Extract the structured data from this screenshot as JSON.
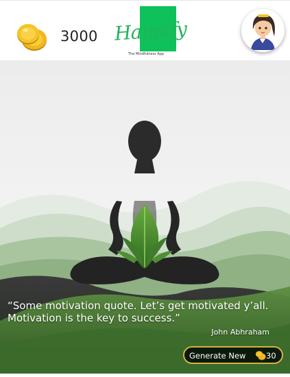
{
  "header": {
    "coin_count": "3000",
    "coin_icon": "gold-coins-icon",
    "logo": {
      "name": "Happify",
      "tagline": "The Mindfulness App",
      "color": "#21b45a"
    },
    "avatar_icon": "user-avatar-icon"
  },
  "main": {
    "illustration": "meditation-figure-illustration",
    "quote": "“Some motivation quote. Let’s get motivated y’all. Motivation is the key to success.”",
    "author": "John Abhraham"
  },
  "action": {
    "generate_label": "Generate New",
    "cost": "30",
    "cost_icon": "gold-coin-icon",
    "border_color": "#d3b342"
  }
}
